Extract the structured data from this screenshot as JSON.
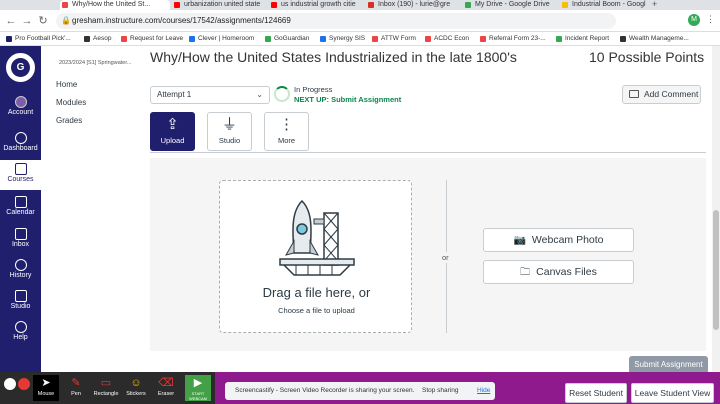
{
  "browser": {
    "tabs": [
      {
        "label": "Why/How the United St...",
        "color": "#e44"
      },
      {
        "label": "urbanization united state",
        "color": "#f00"
      },
      {
        "label": "us industrial growth citie",
        "color": "#f00"
      },
      {
        "label": "Inbox (190) - lurie@gre",
        "color": "#d93025"
      },
      {
        "label": "My Drive - Google Drive",
        "color": "#34a853"
      },
      {
        "label": "Industrial Boom - Googl",
        "color": "#fbbc04"
      }
    ],
    "url": "gresham.instructure.com/courses/17542/assignments/124669",
    "bookmarks": [
      {
        "label": "Pro Football Pick'...",
        "color": "#1f1f6e"
      },
      {
        "label": "Aesop",
        "color": "#333"
      },
      {
        "label": "Request for Leave",
        "color": "#e44"
      },
      {
        "label": "Clever | Homeroom",
        "color": "#1a73e8"
      },
      {
        "label": "GoGuardian",
        "color": "#34a853"
      },
      {
        "label": "Synergy SIS",
        "color": "#1a73e8"
      },
      {
        "label": "ATTW Form",
        "color": "#e44"
      },
      {
        "label": "ACDC Econ",
        "color": "#e44"
      },
      {
        "label": "Referral Form 23-...",
        "color": "#e44"
      },
      {
        "label": "Incident Report",
        "color": "#34a853"
      },
      {
        "label": "Wealth Manageme...",
        "color": "#333"
      }
    ],
    "avatar_letter": "M"
  },
  "global_nav": {
    "items": [
      {
        "label": "Account"
      },
      {
        "label": "Dashboard"
      },
      {
        "label": "Courses"
      },
      {
        "label": "Calendar"
      },
      {
        "label": "Inbox"
      },
      {
        "label": "History"
      },
      {
        "label": "Studio"
      },
      {
        "label": "Help"
      }
    ]
  },
  "course_nav": {
    "term": "2023/2024 [S1] Springwater...",
    "items": [
      "Home",
      "Modules",
      "Grades"
    ]
  },
  "assignment": {
    "title": "Why/How the United States Industrialized in the late 1800's",
    "points": "10 Possible Points",
    "attempt": "Attempt 1",
    "status": "In Progress",
    "next_up": "NEXT UP: Submit Assignment",
    "add_comment": "Add Comment",
    "submission_types": [
      "Upload",
      "Studio",
      "More"
    ],
    "drop_text": "Drag a file here, or",
    "drop_sub": "Choose a file to upload",
    "or_text": "or",
    "webcam_label": "Webcam Photo",
    "canvas_files_label": "Canvas Files",
    "submit_label": "Submit Assignment"
  },
  "screencastify": {
    "tools": [
      "Mouse",
      "Pen",
      "Rectangle",
      "Stickers",
      "Eraser",
      "START WEBCAM"
    ],
    "share_text": "Screencastify - Screen Video Recorder is sharing your screen.",
    "stop_sharing": "Stop sharing",
    "hide": "Hide"
  },
  "student_view": {
    "reset": "Reset Student",
    "leave": "Leave Student View"
  }
}
